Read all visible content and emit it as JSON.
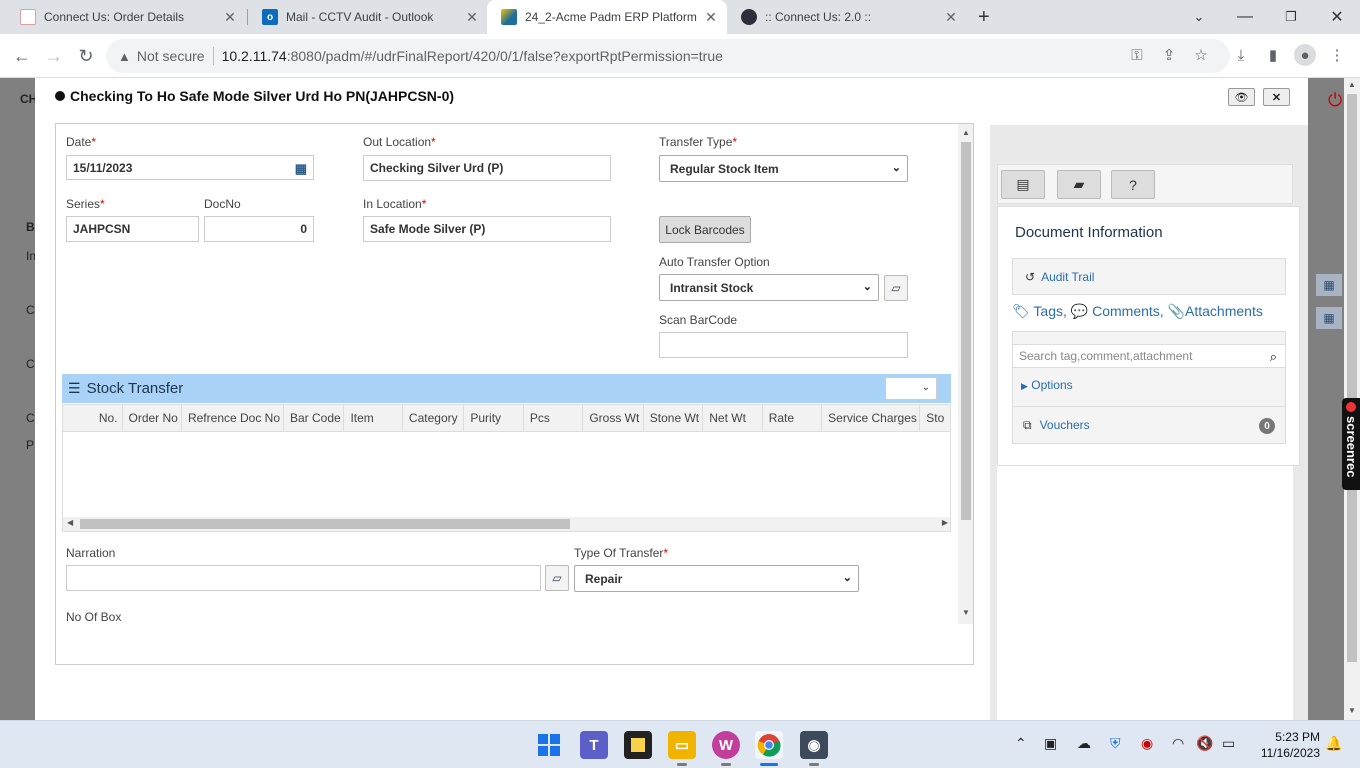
{
  "browser": {
    "tabs": [
      {
        "title": "Connect Us: Order Details",
        "color": "#d9534f"
      },
      {
        "title": "Mail - CCTV Audit - Outlook",
        "color": "#0f6cbd"
      },
      {
        "title": "24_2-Acme Padm ERP Platform",
        "color": "#1c6e9c"
      },
      {
        "title": ":: Connect Us: 2.0 ::",
        "color": "#2b2f3a"
      }
    ],
    "new_tab_icon": "+",
    "window_controls": [
      "chevron-down-icon",
      "minimize-icon",
      "restore-icon",
      "close-icon"
    ],
    "not_secure": "Not secure",
    "url_host": "10.2.11.74",
    "url_rest": ":8080/padm/#/udrFinalReport/420/0/1/false?exportRptPermission=true"
  },
  "background": {
    "left_letters": [
      "CH",
      "B",
      "In",
      "C",
      "C",
      "C",
      "P"
    ]
  },
  "modal": {
    "title": "Checking To Ho Safe Mode Silver Urd Ho PN(JAHPCSN-0)",
    "form": {
      "date_label": "Date",
      "date_value": "15/11/2023",
      "out_location_label": "Out Location",
      "out_location_value": "Checking Silver Urd (P)",
      "transfer_type_label": "Transfer Type",
      "transfer_type_value": "Regular Stock Item",
      "series_label": "Series",
      "series_value": "JAHPCSN",
      "docno_label": "DocNo",
      "docno_value": "0",
      "in_location_label": "In Location",
      "in_location_value": "Safe Mode Silver (P)",
      "lock_barcodes": "Lock Barcodes",
      "auto_transfer_label": "Auto Transfer Option",
      "auto_transfer_value": "Intransit Stock",
      "scan_barcode_label": "Scan BarCode",
      "scan_barcode_value": "",
      "stock_transfer_title": "Stock Transfer",
      "columns": [
        "No.",
        "Order No",
        "Refrence Doc No",
        "Bar Code",
        "Item",
        "Category",
        "Purity",
        "Pcs",
        "Gross Wt",
        "Stone Wt",
        "Net Wt",
        "Rate",
        "Service Charges",
        "Sto"
      ],
      "narration_label": "Narration",
      "narration_value": "",
      "type_of_transfer_label": "Type Of Transfer",
      "type_of_transfer_value": "Repair",
      "no_of_box_label": "No Of Box",
      "required_mark": "*"
    },
    "right": {
      "document_information": "Document Information",
      "audit_trail": "Audit Trail",
      "tags": "Tags,",
      "comments": "Comments,",
      "attachments": "Attachments",
      "search_placeholder": "Search tag,comment,attachment",
      "options": "Options",
      "vouchers": "Vouchers",
      "vouchers_count": "0"
    }
  },
  "screenrec": "screenrec",
  "taskbar": {
    "time": "5:23 PM",
    "date": "11/16/2023"
  }
}
